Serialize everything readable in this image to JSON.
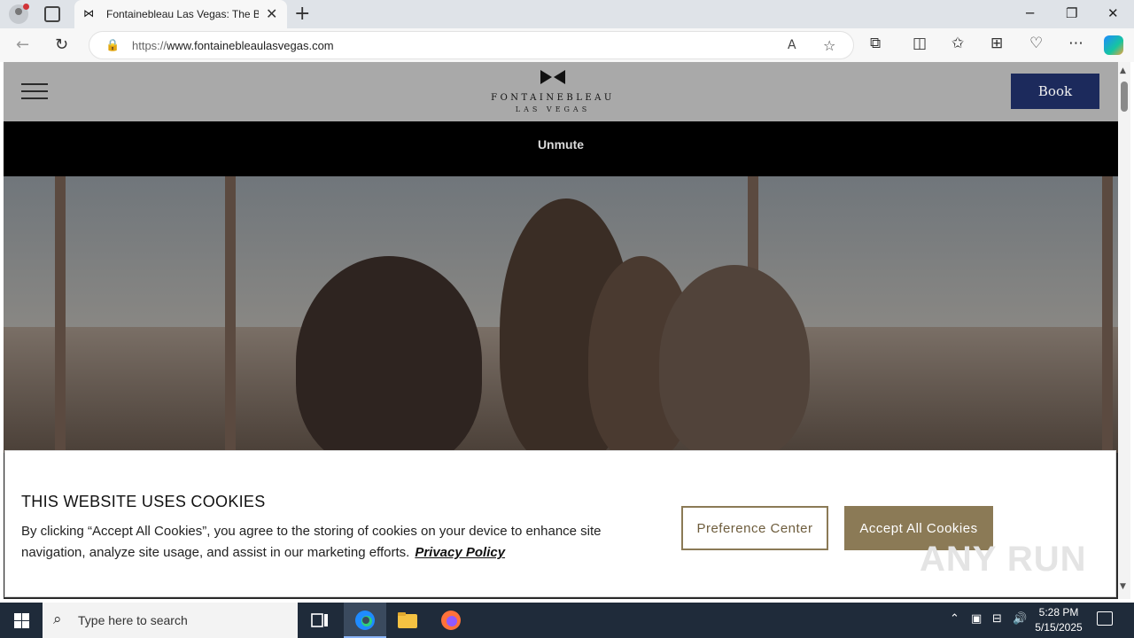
{
  "browser": {
    "tab_title": "Fontainebleau Las Vegas: The Best",
    "url_prefix": "https://",
    "url_host": "www.fontainebleaulasvegas.com",
    "tab_close": "✕",
    "new_tab": "+",
    "win_minimize": "─",
    "win_restore": "❐",
    "win_close": "✕",
    "back": "←",
    "refresh": "↻",
    "lock": "🔒",
    "read_aloud": "A",
    "favorite": "☆"
  },
  "site": {
    "logo_name": "FONTAINEBLEAU",
    "logo_sub": "LAS VEGAS",
    "book_label": "Book",
    "unmute_label": "Unmute"
  },
  "cookie": {
    "title": "THIS WEBSITE USES COOKIES",
    "body": "By clicking “Accept All Cookies”, you agree to the storing of cookies on your device to enhance site navigation, analyze site usage, and assist in our marketing efforts.",
    "privacy_link": "Privacy Policy",
    "preference_label": "Preference Center",
    "accept_label": "Accept All Cookies"
  },
  "watermark": "ANY RUN",
  "taskbar": {
    "search_placeholder": "Type here to search",
    "time": "5:28 PM",
    "date": "5/15/2025"
  },
  "colors": {
    "book_button": "#1c2a5c",
    "cookie_accent": "#8b7a56",
    "header_bg": "#a9a9a9"
  }
}
